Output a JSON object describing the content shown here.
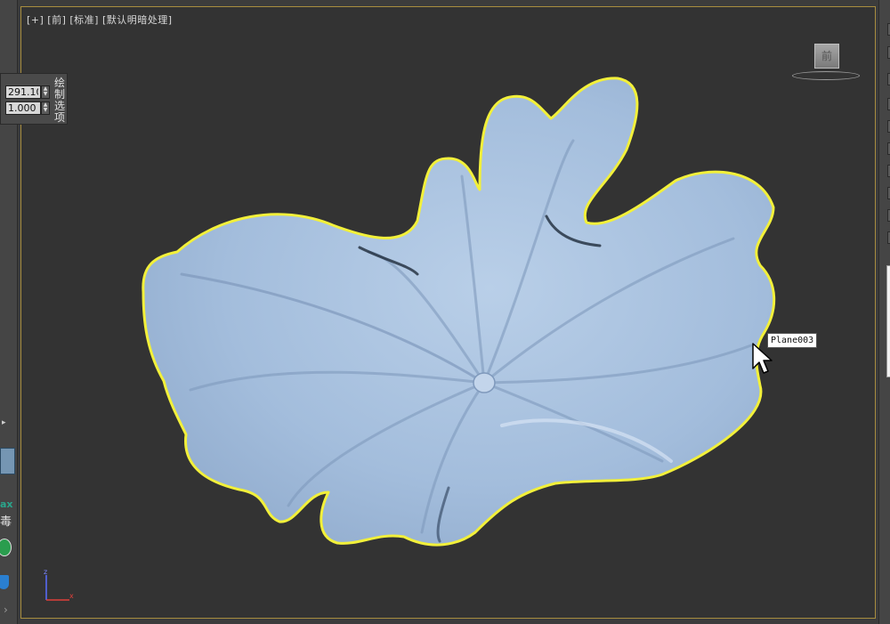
{
  "viewport": {
    "label": "[+] [前] [标准] [默认明暗处理]",
    "viewcube_face": "前",
    "selected_object": "Plane003",
    "object_color": "#a8c2e0",
    "selection_outline": "#f2f03a",
    "axes": {
      "z": "z",
      "x": "x"
    }
  },
  "draw_panel": {
    "title": "绘制选项",
    "field1": "291.10",
    "field2": "1.000"
  },
  "sidebar": {
    "max_label": "ax",
    "du_label": "毒"
  },
  "icons": {
    "viewcube": "viewcube-icon",
    "cursor": "mouse-pointer-icon",
    "axis": "axis-gizmo-icon",
    "antivirus": "green-antivirus-icon",
    "shield": "shield-icon",
    "chevron": "chevron-right-icon"
  }
}
